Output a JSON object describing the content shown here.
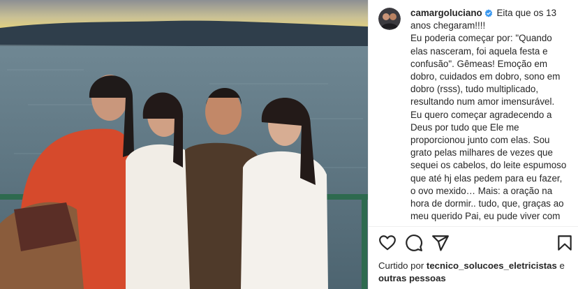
{
  "post": {
    "username": "camargoluciano",
    "caption_first_line": "Eita que os 13 anos chegaram!!!!",
    "caption_body": "Eu poderia começar por: \"Quando elas nasceram, foi aquela festa e confusão\". Gêmeas! Emoção em dobro, cuidados em dobro, sono em dobro (rsss), tudo multiplicado, resultando num amor imensurável. Eu quero começar agradecendo a Deus por tudo que Ele me proporcionou junto com elas. Sou grato pelas milhares de vezes que sequei os cabelos, do leite espumoso que até hj elas pedem para eu fazer, o ovo mexido… Mais: a oração na hora de dormir.. tudo, que, graças ao meu querido Pai, eu pude viver com elas. Filhas, feliz",
    "likes_prefix": "Curtido por",
    "likes_user": "tecnico_solucoes_eletricistas",
    "likes_suffix": "e",
    "likes_others": "outras pessoas"
  },
  "icons": {
    "like": "heart-icon",
    "comment": "comment-icon",
    "share": "paper-plane-icon",
    "save": "bookmark-icon",
    "verified": "verified-badge-icon"
  },
  "colors": {
    "verified_blue": "#3897f0",
    "text": "#262626",
    "divider": "#efefef"
  }
}
